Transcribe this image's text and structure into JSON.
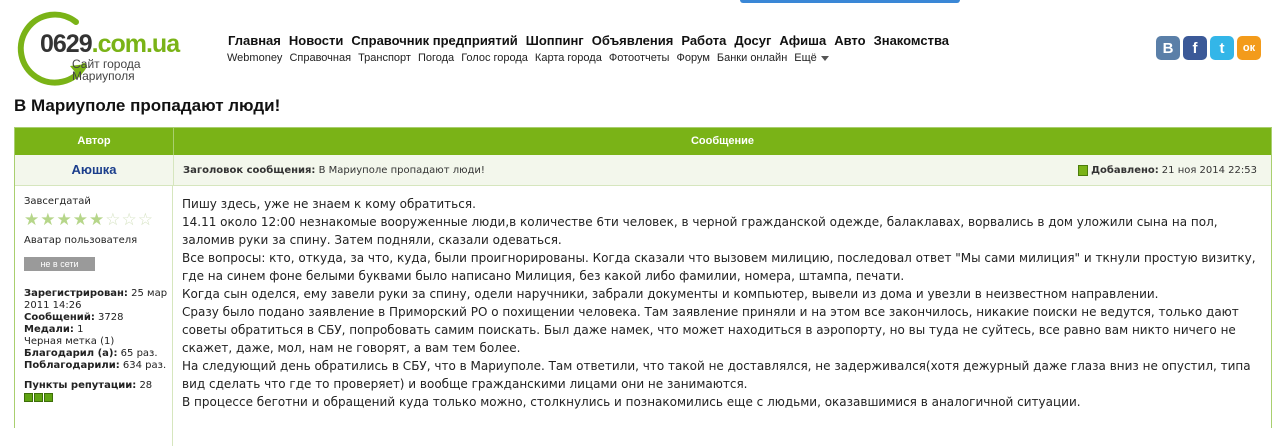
{
  "header": {
    "logo_number": "0629",
    "logo_domain": ".com.ua",
    "logo_subtitle_1": "Сайт города",
    "logo_subtitle_2": "Мариуполя",
    "main_nav": [
      "Главная",
      "Новости",
      "Справочник предприятий",
      "Шоппинг",
      "Объявления",
      "Работа",
      "Досуг",
      "Афиша",
      "Авто",
      "Знакомства"
    ],
    "sub_nav": [
      "Webmoney",
      "Справочная",
      "Транспорт",
      "Погода",
      "Голос города",
      "Карта города",
      "Фотоотчеты",
      "Форум",
      "Банки онлайн"
    ],
    "sub_nav_more": "Ещё",
    "social": [
      {
        "icon": "vk-icon",
        "glyph": "В"
      },
      {
        "icon": "facebook-icon",
        "glyph": "f"
      },
      {
        "icon": "twitter-icon",
        "glyph": "t"
      },
      {
        "icon": "odnoklassniki-icon",
        "glyph": "ок"
      }
    ]
  },
  "page_title": "В Мариуполе пропадают люди!",
  "table": {
    "col_author": "Автор",
    "col_message": "Сообщение"
  },
  "post": {
    "author": "Аюшка",
    "subject_label": "Заголовок сообщения:",
    "subject": "В Мариуполе пропадают люди!",
    "added_label": "Добавлено:",
    "added_date": "21 ноя 2014 22:53",
    "rank": "Завсегдатай",
    "stars_filled": 5,
    "stars_total": 8,
    "avatar_text": "Аватар пользователя",
    "status": "не в сети",
    "registered_label": "Зарегистрирован:",
    "registered_value_1": "25 мар",
    "registered_value_2": "2011 14:26",
    "messages_label": "Сообщений:",
    "messages_value": "3728",
    "medals_label": "Медали:",
    "medals_value": "1",
    "black_mark": "Черная метка (1)",
    "thanked_label": "Благодарил (а):",
    "thanked_value": "65 раз.",
    "was_thanked_label": "Поблагодарили:",
    "was_thanked_value": "634 раз.",
    "reputation_label": "Пункты репутации:",
    "reputation_value": "28",
    "reputation_dots": 3,
    "body": [
      "Пишу здесь, уже не знаем к кому обратиться.",
      "14.11 около 12:00 незнакомые вооруженные люди,в количестве 6ти человек, в черной гражданской одежде, балаклавах, ворвались в дом уложили сына на пол, заломив руки за спину. Затем подняли, сказали одеваться.",
      "Все вопросы: кто, откуда, за что, куда, были проигнорированы. Когда сказали что вызовем милицию, последовал ответ \"Мы сами милиция\" и ткнули простую визитку, где на синем фоне белыми буквами было написано Милиция, без какой либо фамилии, номера, штампа, печати.",
      "Когда сын оделся, ему завели руки за спину, одели наручники, забрали документы и компьютер, вывели из дома и увезли в неизвестном направлении.",
      "Сразу было подано заявление в Приморский РО о похищении человека. Там заявление приняли и на этом все закончилось, никакие поиски не ведутся, только дают советы обратиться в СБУ, попробовать самим поискать. Был даже намек, что может находиться в аэропорту, но вы туда не суйтесь, все равно вам никто ничего не скажет, даже, мол, нам не говорят, а вам тем более.",
      "На следующий день обратились в СБУ, что в Мариуполе. Там ответили, что такой не доставлялся, не задерживался(хотя дежурный даже глаза вниз не опустил, типа вид сделать что где то проверяет) и вообще гражданскими лицами они не занимаются.",
      "В процессе беготни и обращений куда только можно, столкнулись и познакомились еще с людьми, оказавшимися в аналогичной ситуации."
    ]
  },
  "colors": {
    "accent_green": "#7ab317",
    "link_blue": "#1b3e8c"
  }
}
